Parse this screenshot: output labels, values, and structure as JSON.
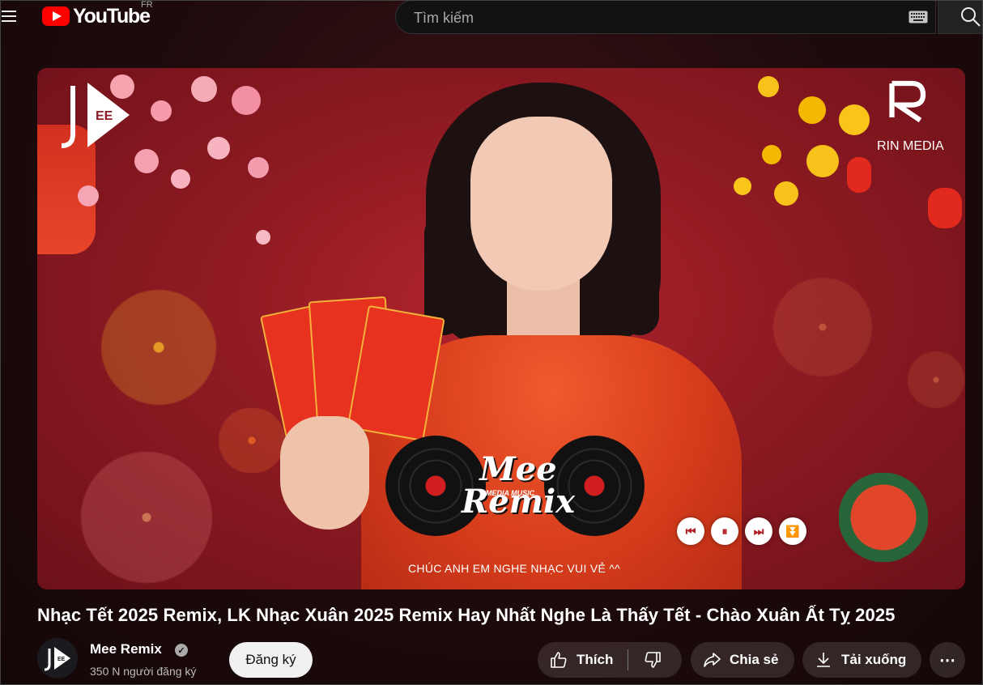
{
  "header": {
    "logo_text": "YouTube",
    "country_code": "FR",
    "search_placeholder": "Tìm kiếm"
  },
  "video": {
    "top_left_logo_text": "MEE",
    "top_right_logo_text": "RIN MEDIA",
    "overlay_logo_main": "Mee Remix",
    "overlay_logo_sub": "MEDIA MUSIC",
    "overlay_caption": "CHÚC ANH EM NGHE NHẠC VUI VẺ ^^",
    "overlay_controls": [
      "previous",
      "pause",
      "next",
      "download"
    ]
  },
  "title": "Nhạc Tết 2025 Remix, LK Nhạc Xuân 2025 Remix Hay Nhất Nghe Là Thấy Tết - Chào Xuân Ất Tỵ 2025",
  "channel": {
    "name": "Mee Remix",
    "subscribers": "350 N người đăng ký",
    "subscribe_label": "Đăng ký"
  },
  "actions": {
    "like_label": "Thích",
    "share_label": "Chia sẻ",
    "download_label": "Tải xuống",
    "more_label": "⋯"
  },
  "colors": {
    "brand_red": "#ff0000",
    "video_bg": "#8e1a22",
    "pill_bg": "rgba(255,255,255,0.12)"
  }
}
